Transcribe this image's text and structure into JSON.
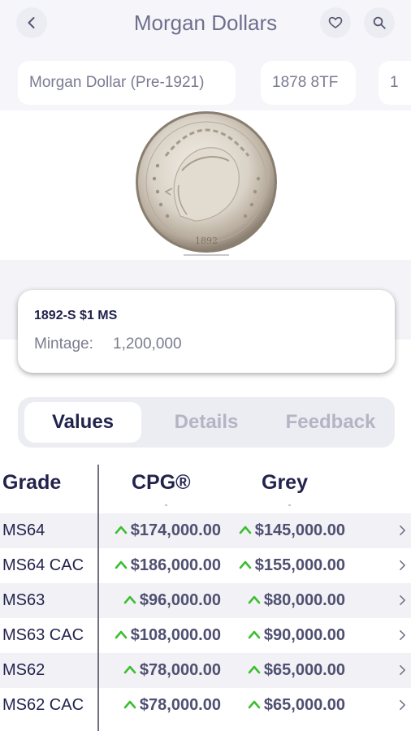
{
  "header": {
    "title": "Morgan Dollars",
    "back_icon": "chevron-left-icon",
    "favorite_icon": "heart-icon",
    "search_icon": "search-icon"
  },
  "chips": [
    "Morgan Dollar (Pre-1921)",
    "1878 8TF",
    "1"
  ],
  "coin": {
    "name": "1892-S $1  MS",
    "mintage_label": "Mintage:",
    "mintage_value": "1,200,000"
  },
  "tabs": [
    "Values",
    "Details",
    "Feedback"
  ],
  "active_tab": "Values",
  "table": {
    "headers": {
      "grade": "Grade",
      "cpg": "CPG®",
      "grey": "Grey"
    },
    "rows": [
      {
        "grade": "MS64",
        "cpg": "$174,000.00",
        "grey": "$145,000.00"
      },
      {
        "grade": "MS64 CAC",
        "cpg": "$186,000.00",
        "grey": "$155,000.00"
      },
      {
        "grade": "MS63",
        "cpg": "$96,000.00",
        "grey": "$80,000.00"
      },
      {
        "grade": "MS63 CAC",
        "cpg": "$108,000.00",
        "grey": "$90,000.00"
      },
      {
        "grade": "MS62",
        "cpg": "$78,000.00",
        "grey": "$65,000.00"
      },
      {
        "grade": "MS62 CAC",
        "cpg": "$78,000.00",
        "grey": "$65,000.00"
      }
    ]
  },
  "colors": {
    "accent": "#22234d",
    "trend_up": "#3bbf2f",
    "muted": "#7a7b92"
  }
}
